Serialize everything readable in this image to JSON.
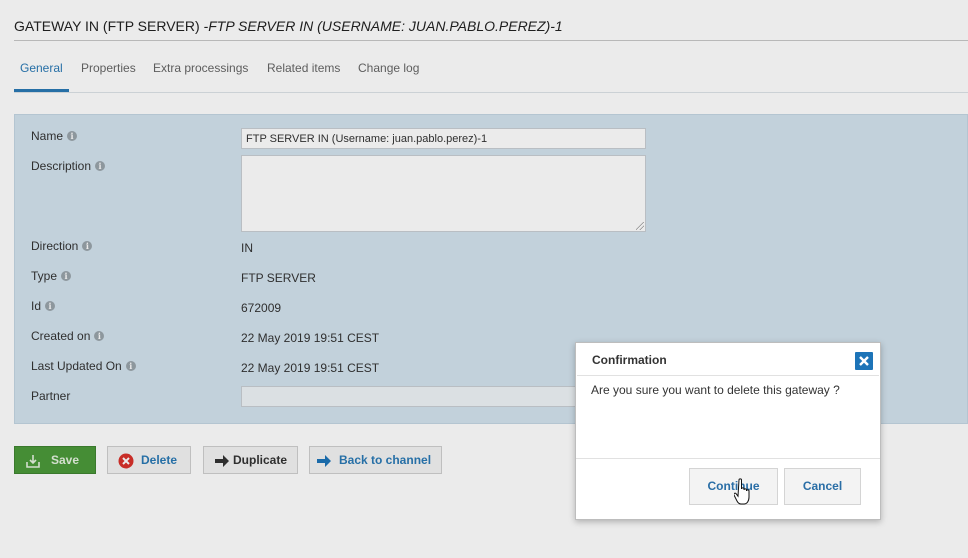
{
  "header": {
    "title_main": "GATEWAY IN (FTP SERVER) ",
    "title_sub": "-FTP SERVER IN (USERNAME: JUAN.PABLO.PEREZ)-1"
  },
  "tabs": [
    {
      "label": "General",
      "active": true
    },
    {
      "label": "Properties"
    },
    {
      "label": "Extra processings"
    },
    {
      "label": "Related items"
    },
    {
      "label": "Change log"
    }
  ],
  "form": {
    "name_label": "Name",
    "name_value": "FTP SERVER IN (Username: juan.pablo.perez)-1",
    "description_label": "Description",
    "description_value": "",
    "direction_label": "Direction",
    "direction_value": "IN",
    "type_label": "Type",
    "type_value": "FTP SERVER",
    "id_label": "Id",
    "id_value": "672009",
    "created_label": "Created on",
    "created_value": "22 May 2019 19:51 CEST",
    "updated_label": "Last Updated On",
    "updated_value": "22 May 2019 19:51 CEST",
    "partner_label": "Partner",
    "info_glyph": "i"
  },
  "actions": {
    "save_label": "Save",
    "delete_label": "Delete",
    "duplicate_label": "Duplicate",
    "back_label": "Back to channel"
  },
  "dialog": {
    "title": "Confirmation",
    "message": "Are you sure you want to delete this gateway ?",
    "continue_label": "Continue",
    "cancel_label": "Cancel"
  },
  "colors": {
    "accent": "#2a79b5",
    "panel_bg": "#d3e3ee",
    "save_green": "#4b9a3a",
    "delete_red": "#d9312b",
    "close_blue": "#1d74b8"
  },
  "icons": {
    "info": "info-icon",
    "save": "save-icon",
    "delete": "delete-icon",
    "duplicate": "arrow-right-icon",
    "back": "arrow-right-icon",
    "close": "close-icon",
    "cursor": "hand-cursor-icon"
  }
}
